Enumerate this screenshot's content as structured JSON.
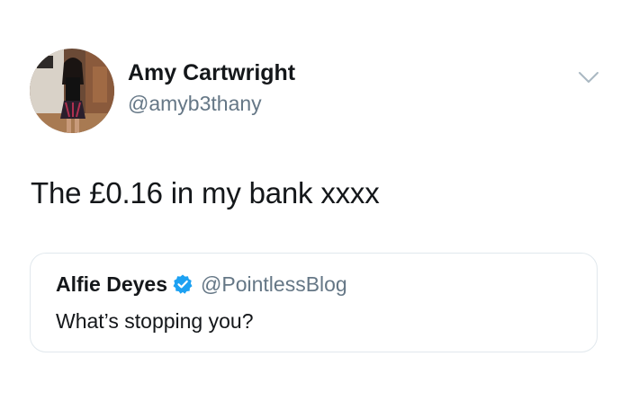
{
  "tweet": {
    "author": {
      "display_name": "Amy Cartwright",
      "handle": "@amyb3thany",
      "avatar_icon": "profile-photo"
    },
    "menu_icon": "chevron-down-icon",
    "text": "The £0.16 in my bank xxxx",
    "quoted_tweet": {
      "display_name": "Alfie Deyes",
      "verified": true,
      "verified_icon": "verified-badge-icon",
      "handle": "@PointlessBlog",
      "text": "What’s stopping you?"
    }
  },
  "colors": {
    "text_primary": "#14171a",
    "text_secondary": "#657786",
    "border": "#e1e8ed",
    "verified_blue": "#1da1f2",
    "chevron": "#aab8c2"
  }
}
